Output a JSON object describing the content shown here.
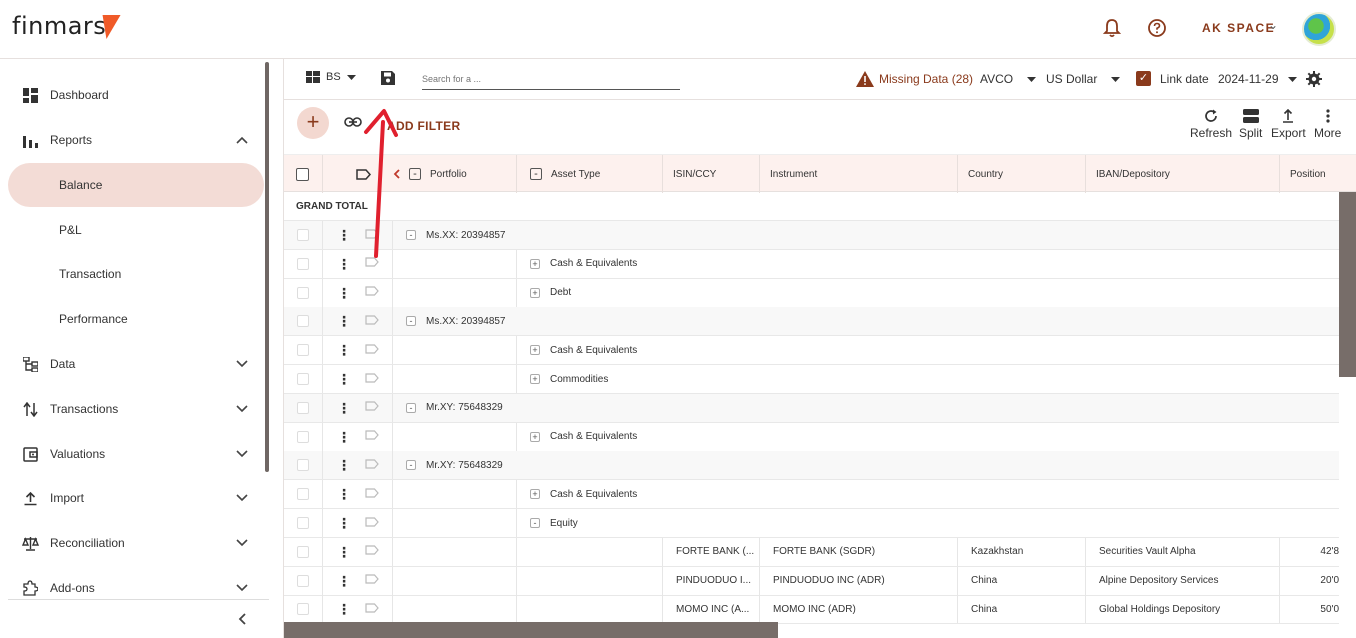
{
  "app": {
    "logo": "finmars",
    "space_label": "AK SPACE",
    "icons": {
      "bell": "bell-icon",
      "help": "help-circle-icon",
      "avatar": "avatar"
    }
  },
  "sidebar": {
    "items": [
      {
        "label": "Dashboard",
        "icon": "dashboard-icon"
      },
      {
        "label": "Reports",
        "icon": "bar-chart-icon",
        "expanded": true
      },
      {
        "label": "Data",
        "icon": "data-tree-icon"
      },
      {
        "label": "Transactions",
        "icon": "transfer-icon"
      },
      {
        "label": "Valuations",
        "icon": "wallet-icon"
      },
      {
        "label": "Import",
        "icon": "upload-icon"
      },
      {
        "label": "Reconciliation",
        "icon": "scale-icon"
      },
      {
        "label": "Add-ons",
        "icon": "puzzle-icon"
      }
    ],
    "reports_sub": [
      {
        "label": "Balance",
        "active": true
      },
      {
        "label": "P&L"
      },
      {
        "label": "Transaction"
      },
      {
        "label": "Performance"
      }
    ]
  },
  "toolbar": {
    "layout_name": "BS",
    "search_placeholder": "Search for a ...",
    "missing_data": "Missing Data (28)",
    "cost_method": "AVCO",
    "currency": "US Dollar",
    "link_date_label": "Link date",
    "date": "2024-11-29",
    "add_filter": "ADD FILTER",
    "actions": {
      "refresh": "Refresh",
      "split": "Split",
      "export": "Export",
      "more": "More"
    },
    "accent": "#8a3a1c"
  },
  "grid": {
    "columns": [
      "Portfolio",
      "Asset Type",
      "ISIN/CCY",
      "Instrument",
      "Country",
      "IBAN/Depository",
      "Position"
    ],
    "grand_total": "GRAND TOTAL",
    "rows": [
      {
        "type": "portfolio",
        "label": "Ms.XX: 20394857",
        "exp": "-"
      },
      {
        "type": "asset",
        "label": "Cash & Equivalents",
        "exp": "+"
      },
      {
        "type": "asset",
        "label": "Debt",
        "exp": "+"
      },
      {
        "type": "portfolio",
        "label": "Ms.XX: 20394857",
        "exp": "-"
      },
      {
        "type": "asset",
        "label": "Cash & Equivalents",
        "exp": "+"
      },
      {
        "type": "asset",
        "label": "Commodities",
        "exp": "+"
      },
      {
        "type": "portfolio",
        "label": "Mr.XY: 75648329",
        "exp": "-"
      },
      {
        "type": "asset",
        "label": "Cash & Equivalents",
        "exp": "+"
      },
      {
        "type": "portfolio",
        "label": "Mr.XY: 75648329",
        "exp": "-"
      },
      {
        "type": "asset",
        "label": "Cash & Equivalents",
        "exp": "+"
      },
      {
        "type": "asset",
        "label": "Equity",
        "exp": "-"
      },
      {
        "type": "item",
        "isin": "FORTE BANK (...",
        "instrument": "FORTE BANK (SGDR)",
        "country": "Kazakhstan",
        "iban": "Securities Vault Alpha",
        "position": "42'8"
      },
      {
        "type": "item",
        "isin": "PINDUODUO I...",
        "instrument": "PINDUODUO INC (ADR)",
        "country": "China",
        "iban": "Alpine Depository Services",
        "position": "20'0"
      },
      {
        "type": "item",
        "isin": "MOMO INC (A...",
        "instrument": "MOMO INC (ADR)",
        "country": "China",
        "iban": "Global Holdings Depository",
        "position": "50'0"
      }
    ]
  }
}
